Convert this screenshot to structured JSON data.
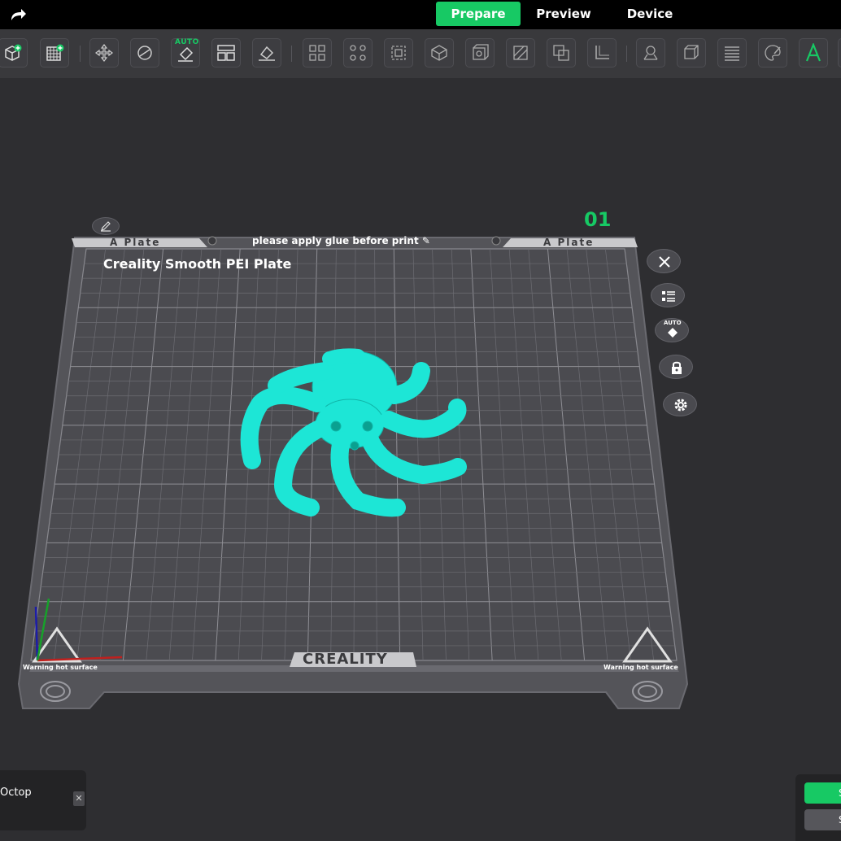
{
  "topbar": {
    "redo_icon": "redo-arrow-icon",
    "tabs": [
      {
        "label": "Prepare",
        "active": true
      },
      {
        "label": "Preview",
        "active": false
      },
      {
        "label": "Device",
        "active": false
      }
    ]
  },
  "toolbar": {
    "auto_label": "AUTO",
    "tools": [
      "add-object-icon",
      "add-plate-icon",
      "move-icon",
      "rotate-icon",
      "auto-orient-icon",
      "arrange-icon",
      "lay-on-face-icon",
      "split-objects-icon",
      "split-parts-icon",
      "variable-layer-icon",
      "cut-icon",
      "hollow-icon",
      "seam-icon",
      "boolean-icon",
      "measure-icon",
      "support-paint-icon",
      "scale-icon",
      "layers-icon",
      "color-paint-icon",
      "text-icon"
    ],
    "text_tool_glyph": "A"
  },
  "plate": {
    "number": "01",
    "left_label": "A Plate",
    "right_label": "A Plate",
    "glue_note": "please apply glue before print",
    "type": "Creality Smooth PEI Plate",
    "brand": "CREALITY",
    "warning_left": "Warning hot surface",
    "warning_right": "Warning hot surface",
    "buttons": [
      {
        "name": "close",
        "icon": "close-icon"
      },
      {
        "name": "object-list",
        "icon": "list-icon"
      },
      {
        "name": "auto-orient",
        "icon": "auto-orient-icon",
        "mini_label": "AUTO"
      },
      {
        "name": "lock",
        "icon": "lock-icon"
      },
      {
        "name": "settings",
        "icon": "gear-icon"
      }
    ]
  },
  "model": {
    "color": "#1de6d6",
    "name_fragment": "Octop"
  },
  "bottom_right": {
    "slice_label": "S",
    "export_label": "S"
  },
  "colors": {
    "accent": "#17c964",
    "bed": "#4b4b50",
    "grid": "#7a7a80",
    "frame": "#5e5e63"
  }
}
